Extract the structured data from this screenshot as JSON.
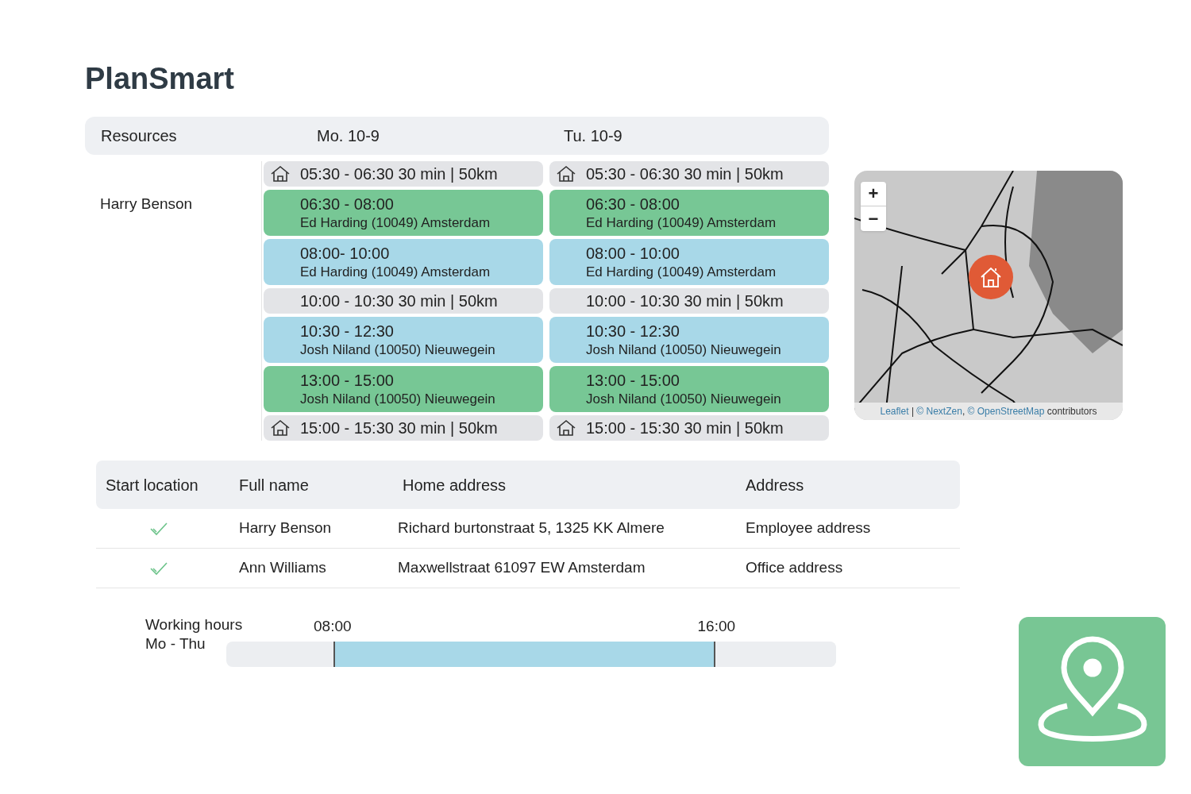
{
  "title": "PlanSmart",
  "schedule": {
    "header": {
      "label": "Resources",
      "days": [
        "Mo. 10-9",
        "Tu. 10-9"
      ]
    },
    "resource": "Harry Benson",
    "days": [
      {
        "entries": [
          {
            "kind": "travel",
            "home": true,
            "text": "05:30 - 06:30 30 min | 50km"
          },
          {
            "kind": "job",
            "color": "#77c795",
            "time": "06:30 - 08:00",
            "detail": "Ed Harding (10049) Amsterdam"
          },
          {
            "kind": "job",
            "color": "#a8d8e8",
            "time": "08:00- 10:00",
            "detail": "Ed Harding (10049) Amsterdam"
          },
          {
            "kind": "travel",
            "home": false,
            "text": "10:00 - 10:30 30 min | 50km"
          },
          {
            "kind": "job",
            "color": "#a8d8e8",
            "time": "10:30 - 12:30",
            "detail": "Josh Niland (10050) Nieuwegein"
          },
          {
            "kind": "job",
            "color": "#77c795",
            "time": "13:00 - 15:00",
            "detail": "Josh Niland (10050) Nieuwegein"
          },
          {
            "kind": "travel",
            "home": true,
            "text": "15:00 - 15:30 30 min | 50km"
          }
        ]
      },
      {
        "entries": [
          {
            "kind": "travel",
            "home": true,
            "text": "05:30 - 06:30 30 min | 50km"
          },
          {
            "kind": "job",
            "color": "#77c795",
            "time": "06:30 - 08:00",
            "detail": "Ed Harding (10049) Amsterdam"
          },
          {
            "kind": "job",
            "color": "#a8d8e8",
            "time": "08:00 - 10:00",
            "detail": "Ed Harding (10049) Amsterdam"
          },
          {
            "kind": "travel",
            "home": false,
            "text": "10:00 - 10:30 30 min | 50km"
          },
          {
            "kind": "job",
            "color": "#a8d8e8",
            "time": "10:30 - 12:30",
            "detail": "Josh Niland (10050) Nieuwegein"
          },
          {
            "kind": "job",
            "color": "#77c795",
            "time": "13:00 - 15:00",
            "detail": "Josh Niland (10050) Nieuwegein"
          },
          {
            "kind": "travel",
            "home": true,
            "text": "15:00 - 15:30 30 min | 50km"
          }
        ]
      }
    ]
  },
  "map": {
    "zoom_in": "+",
    "zoom_out": "−",
    "attribution": [
      {
        "kind": "link",
        "text": "Leaflet"
      },
      {
        "kind": "plain",
        "text": " | "
      },
      {
        "kind": "link",
        "text": "© NextZen"
      },
      {
        "kind": "plain",
        "text": ", "
      },
      {
        "kind": "link",
        "text": "© OpenStreetMap"
      },
      {
        "kind": "plain",
        "text": " contributors"
      }
    ]
  },
  "table": {
    "columns": [
      "Start location",
      "Full name",
      "Home address",
      "Address"
    ],
    "rows": [
      {
        "checked": true,
        "name": "Harry Benson",
        "home": "Richard burtonstraat 5, 1325 KK Almere",
        "address": "Employee address"
      },
      {
        "checked": true,
        "name": "Ann Williams",
        "home": "Maxwellstraat 61097 EW Amsterdam",
        "address": "Office address"
      }
    ]
  },
  "working_hours": {
    "label": "Working hours",
    "days": "Mo - Thu",
    "start": "08:00",
    "end": "16:00",
    "level": 0.76
  }
}
